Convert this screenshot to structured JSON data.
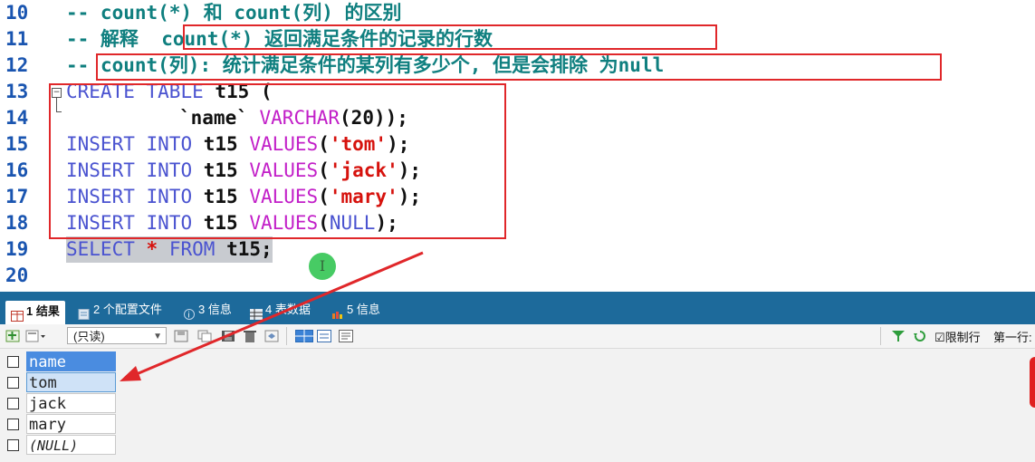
{
  "editor": {
    "lines": [
      {
        "num": "10",
        "comment": "-- count(*) 和 count(列) 的区别"
      },
      {
        "num": "11",
        "comment_prefix": "-- 解释 ",
        "comment_boxed": "count(*) 返回满足条件的记录的行数"
      },
      {
        "num": "12",
        "comment_prefix": "-- ",
        "comment_boxed": "count(列): 统计满足条件的某列有多少个, 但是会排除 为null"
      },
      {
        "num": "13",
        "kw1": "CREATE",
        "kw2": "TABLE",
        "ident": "t15",
        "rest": " ("
      },
      {
        "num": "14",
        "ident": "`name`",
        "type": "VARCHAR",
        "rest": "(20));"
      },
      {
        "num": "15",
        "kw1": "INSERT",
        "kw2": "INTO",
        "ident": "t15",
        "fn": "VALUES",
        "open": "(",
        "str": "'tom'",
        "close": ");"
      },
      {
        "num": "16",
        "kw1": "INSERT",
        "kw2": "INTO",
        "ident": "t15",
        "fn": "VALUES",
        "open": "(",
        "str": "'jack'",
        "close": ");"
      },
      {
        "num": "17",
        "kw1": "INSERT",
        "kw2": "INTO",
        "ident": "t15",
        "fn": "VALUES",
        "open": "(",
        "str": "'mary'",
        "close": ");"
      },
      {
        "num": "18",
        "kw1": "INSERT",
        "kw2": "INTO",
        "ident": "t15",
        "fn": "VALUES",
        "open": "(",
        "null": "NULL",
        "close": ");"
      },
      {
        "num": "19",
        "kw1": "SELECT",
        "star": "*",
        "kw2": "FROM",
        "ident": "t15",
        "rest": ";"
      },
      {
        "num": "20"
      }
    ],
    "cursor_glyph": "I"
  },
  "tabs": [
    {
      "label": "1 结果",
      "active": true
    },
    {
      "label": "2 个配置文件"
    },
    {
      "label": "3 信息"
    },
    {
      "label": "4 表数据"
    },
    {
      "label": "5 信息"
    }
  ],
  "toolbar": {
    "readonly_select": "(只读)",
    "limit_rows_label": "限制行",
    "first_row_label": "第一行:"
  },
  "grid": {
    "header": "name",
    "rows": [
      "tom",
      "jack",
      "mary",
      "(NULL)"
    ]
  },
  "colors": {
    "annotation_red": "#e0272a",
    "tab_bar": "#1d6a9b",
    "header_cell": "#4a8ce0"
  }
}
